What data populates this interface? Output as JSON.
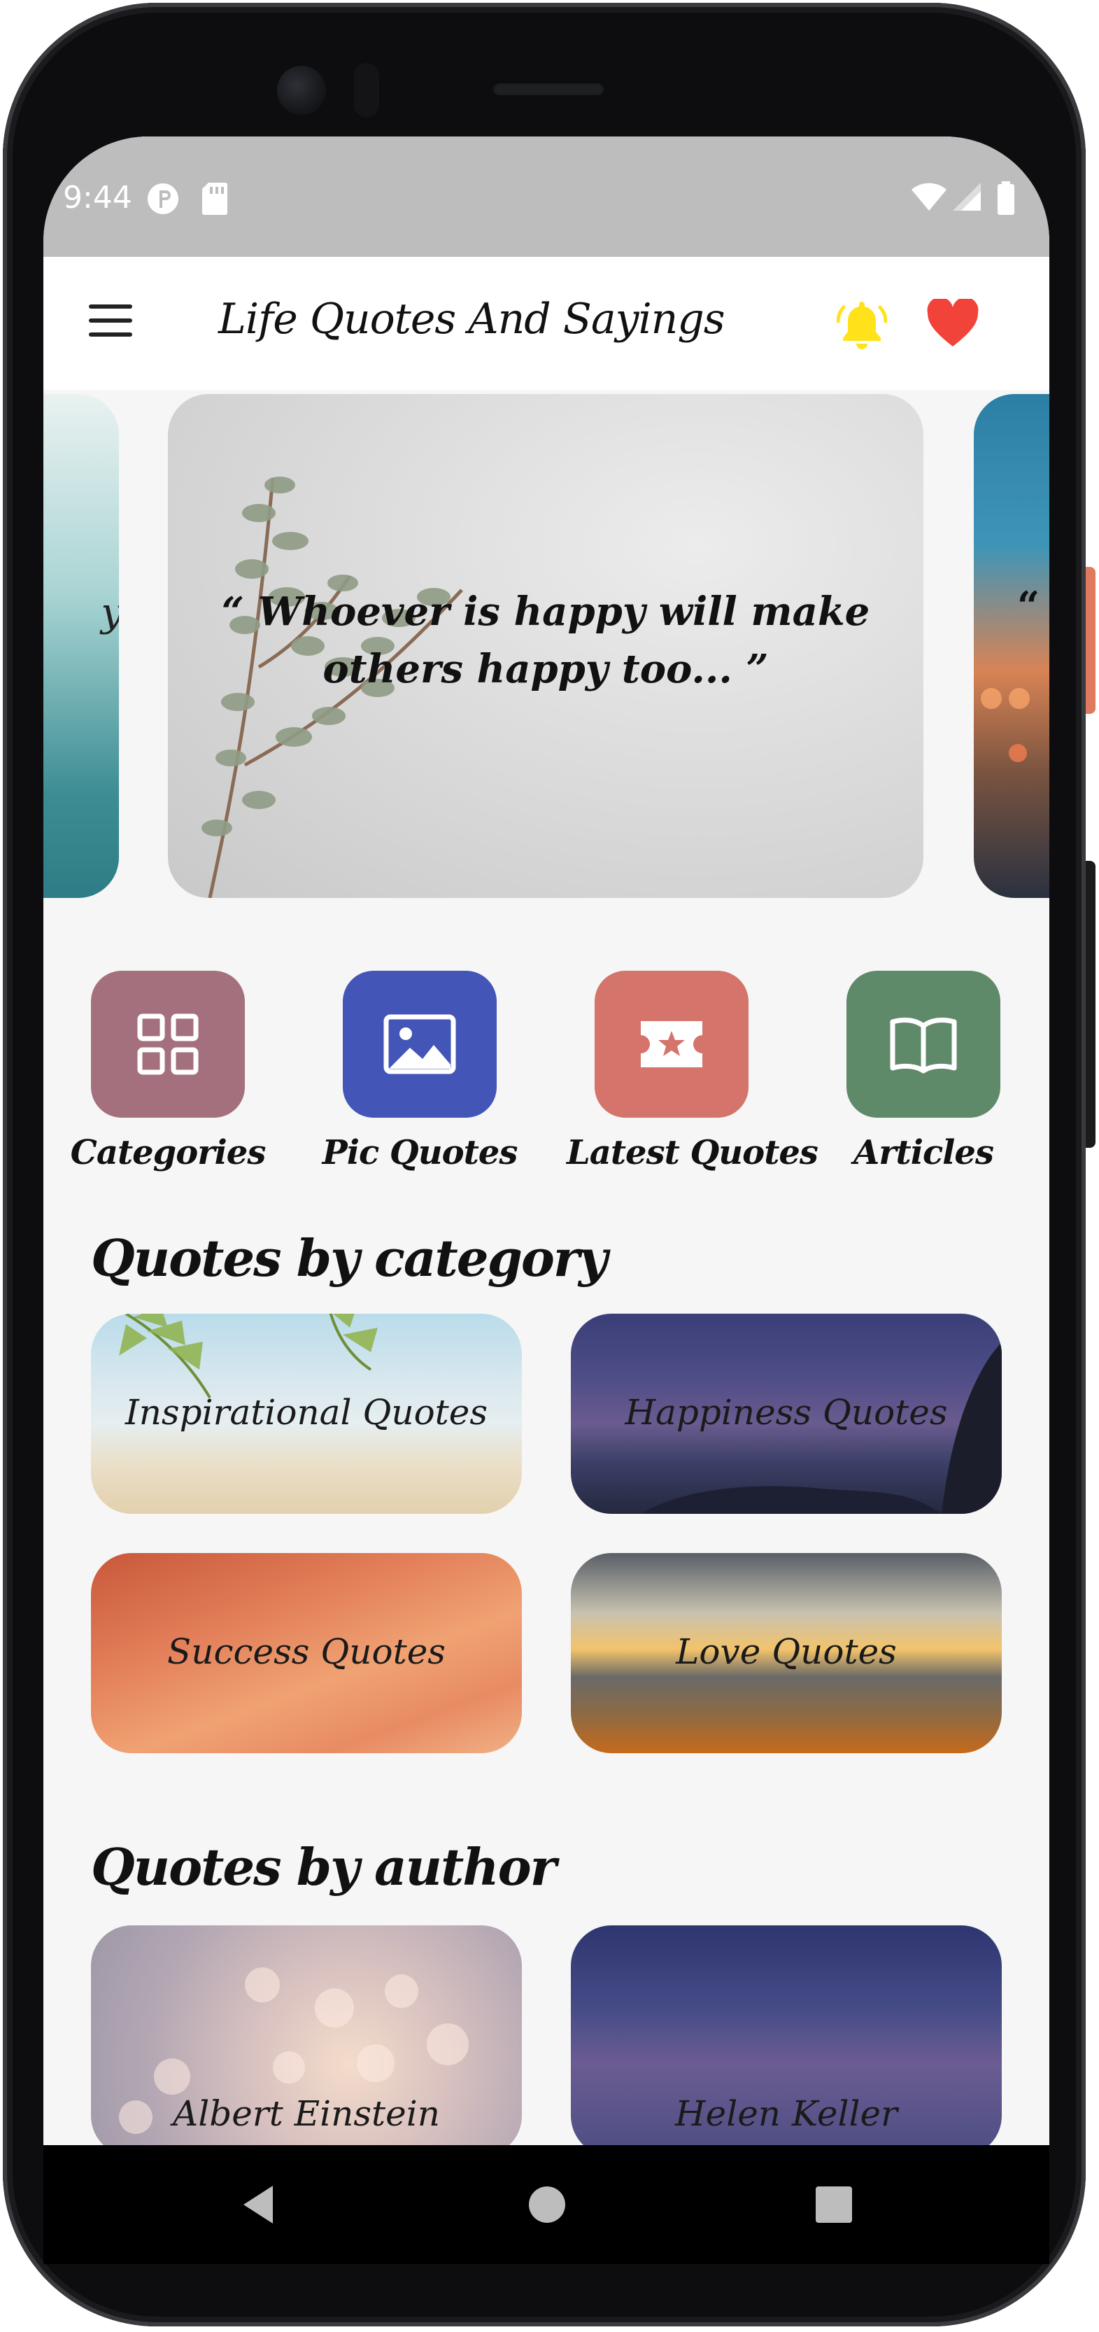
{
  "status_bar": {
    "time": "9:44",
    "icons": [
      "p-badge-icon",
      "sd-card-icon",
      "wifi-icon",
      "signal-icon",
      "battery-icon"
    ]
  },
  "app_bar": {
    "title": "Life Quotes And Sayings",
    "icons": [
      "hamburger-menu-icon",
      "bell-icon",
      "heart-icon"
    ],
    "bell_color": "#FFE21A",
    "heart_color": "#F1433A"
  },
  "carousel": {
    "left_slide_text": "y",
    "main_slide_text": "“ Whoever is happy will make others happy too... ”",
    "right_slide_text": "“ "
  },
  "quick_menu": [
    {
      "label": "Categories",
      "icon": "grid-icon",
      "color": "#A5707D"
    },
    {
      "label": "Pic Quotes",
      "icon": "image-icon",
      "color": "#4355B7"
    },
    {
      "label": "Latest Quotes",
      "icon": "ticket-star-icon",
      "color": "#D4746A"
    },
    {
      "label": "Articles",
      "icon": "book-open-icon",
      "color": "#5F8A6A"
    }
  ],
  "categories_section": {
    "title": "Quotes by category",
    "items": [
      "Inspirational Quotes",
      "Happiness Quotes",
      "Success Quotes",
      "Love Quotes"
    ]
  },
  "authors_section": {
    "title": "Quotes by author",
    "items": [
      "Albert Einstein",
      "Helen Keller"
    ]
  },
  "nav_bar": {
    "icons": [
      "back-icon",
      "home-icon",
      "recents-icon"
    ]
  }
}
